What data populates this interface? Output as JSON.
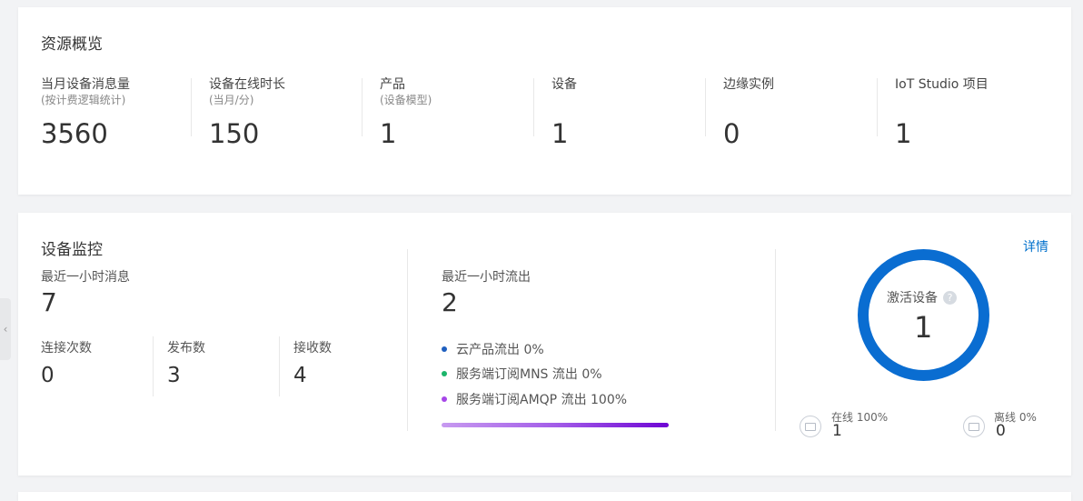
{
  "overview": {
    "title": "资源概览",
    "stats": [
      {
        "label": "当月设备消息量",
        "sub": "(按计费逻辑统计)",
        "value": "3560"
      },
      {
        "label": "设备在线时长",
        "sub": "(当月/分)",
        "value": "150"
      },
      {
        "label": "产品",
        "sub": "(设备模型)",
        "value": "1"
      },
      {
        "label": "设备",
        "sub": "",
        "value": "1"
      },
      {
        "label": "边缘实例",
        "sub": "",
        "value": "0"
      },
      {
        "label": "IoT Studio 项目",
        "sub": "",
        "value": "1"
      }
    ]
  },
  "monitor": {
    "title": "设备监控",
    "detail_link": "详情",
    "recent_messages": {
      "label": "最近一小时消息",
      "value": "7"
    },
    "connect": {
      "label": "连接次数",
      "value": "0"
    },
    "publish": {
      "label": "发布数",
      "value": "3"
    },
    "receive": {
      "label": "接收数",
      "value": "4"
    },
    "outflow": {
      "label": "最近一小时流出",
      "value": "2"
    },
    "legend": [
      {
        "text": "云产品流出  0%",
        "color": "#1f5fbf"
      },
      {
        "text": "服务端订阅MNS 流出  0%",
        "color": "#1bb56a"
      },
      {
        "text": "服务端订阅AMQP 流出  100%",
        "color": "#a646e8"
      }
    ],
    "activated": {
      "label": "激活设备",
      "help": "?",
      "value": "1",
      "ring_color": "#0a6dd1"
    },
    "online": {
      "label": "在线 100%",
      "value": "1"
    },
    "offline": {
      "label": "离线 0%",
      "value": "0"
    }
  },
  "side_tab": {
    "icon": "chevron-left-icon",
    "glyph": "‹"
  }
}
